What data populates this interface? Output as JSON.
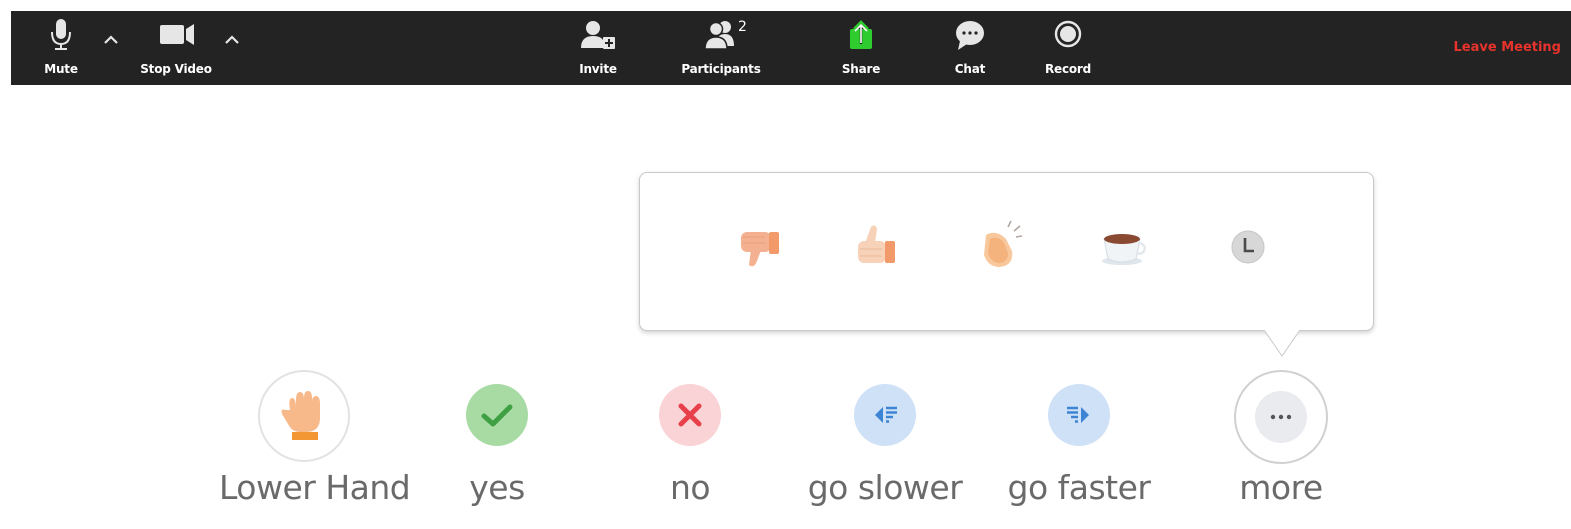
{
  "toolbar": {
    "mute": {
      "label": "Mute",
      "icon": "microphone-icon"
    },
    "audio_options": {
      "icon": "chevron-up-icon"
    },
    "stop_video": {
      "label": "Stop Video",
      "icon": "video-camera-icon"
    },
    "video_options": {
      "icon": "chevron-up-icon"
    },
    "invite": {
      "label": "Invite",
      "icon": "invite-person-icon"
    },
    "participants": {
      "label": "Participants",
      "count": "2",
      "icon": "participants-icon"
    },
    "share": {
      "label": "Share",
      "icon": "share-screen-icon",
      "color": "#2ecc2e"
    },
    "chat": {
      "label": "Chat",
      "icon": "chat-bubble-icon"
    },
    "record": {
      "label": "Record",
      "icon": "record-icon"
    },
    "leave": {
      "label": "Leave Meeting",
      "color": "#e8332c"
    },
    "background": "#232323"
  },
  "more_popup": {
    "items": [
      {
        "name": "thumbs-down",
        "icon": "thumbs-down-icon"
      },
      {
        "name": "thumbs-up",
        "icon": "thumbs-up-icon"
      },
      {
        "name": "clap",
        "icon": "clapping-hands-icon"
      },
      {
        "name": "need-a-break",
        "icon": "coffee-cup-icon"
      },
      {
        "name": "away",
        "icon": "clock-icon"
      }
    ]
  },
  "feedback": [
    {
      "label": "Lower Hand",
      "icon": "raised-hand-icon"
    },
    {
      "label": "yes",
      "icon": "checkmark-icon",
      "color": "#7cc576"
    },
    {
      "label": "no",
      "icon": "x-icon",
      "color": "#e8404a"
    },
    {
      "label": "go slower",
      "icon": "go-slower-icon",
      "color": "#4a8fd8"
    },
    {
      "label": "go faster",
      "icon": "go-faster-icon",
      "color": "#4a8fd8"
    },
    {
      "label": "more",
      "icon": "more-dots-icon"
    }
  ]
}
